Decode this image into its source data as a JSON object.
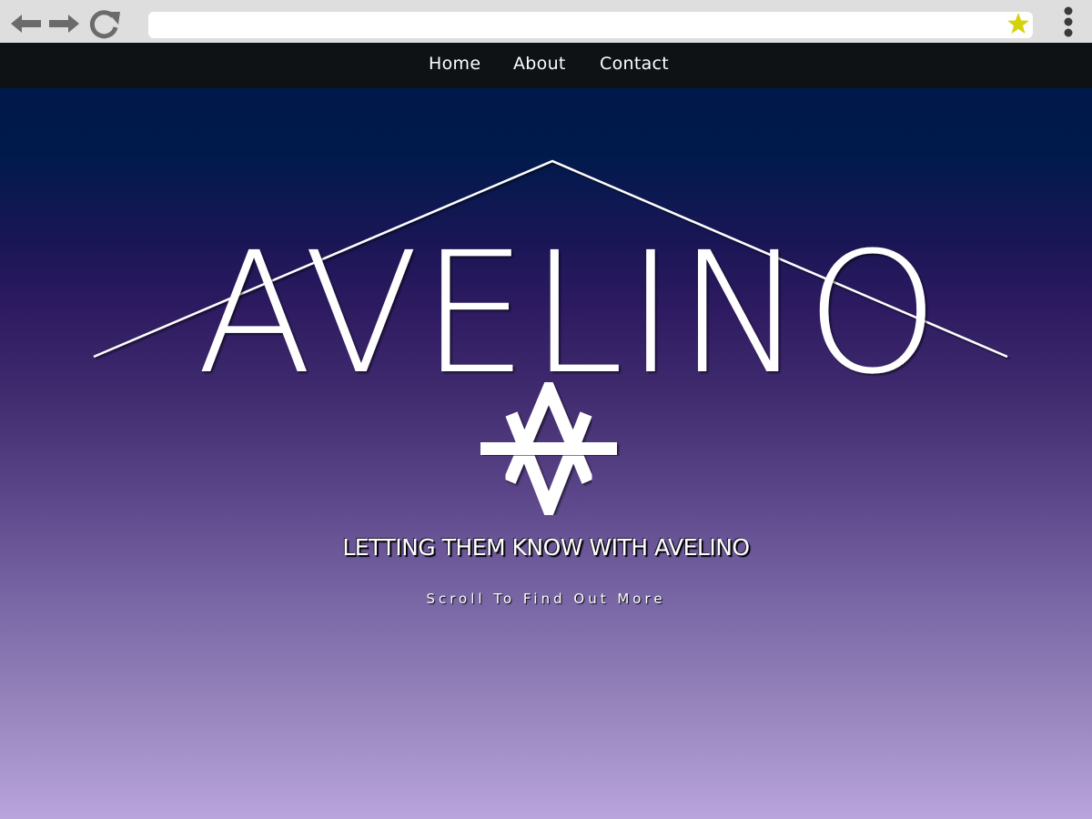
{
  "browser": {
    "url_value": "",
    "back_icon": "arrow-left-icon",
    "forward_icon": "arrow-right-icon",
    "reload_icon": "reload-icon",
    "bookmark_icon": "star-icon",
    "menu_icon": "kebab-menu-icon",
    "bookmark_color": "#d4d20a"
  },
  "nav": {
    "items": [
      {
        "label": "Home"
      },
      {
        "label": "About"
      },
      {
        "label": "Contact"
      }
    ]
  },
  "hero": {
    "logo_text": "AVELINO",
    "tagline": "LETTING THEM KNOW WITH AVELINO",
    "scroll_hint": "Scroll To Find Out More"
  },
  "colors": {
    "nav_bg": "#0f1215",
    "hero_top": "#00184a",
    "hero_mid": "#2d1a60",
    "hero_bottom": "#b9a4de"
  }
}
